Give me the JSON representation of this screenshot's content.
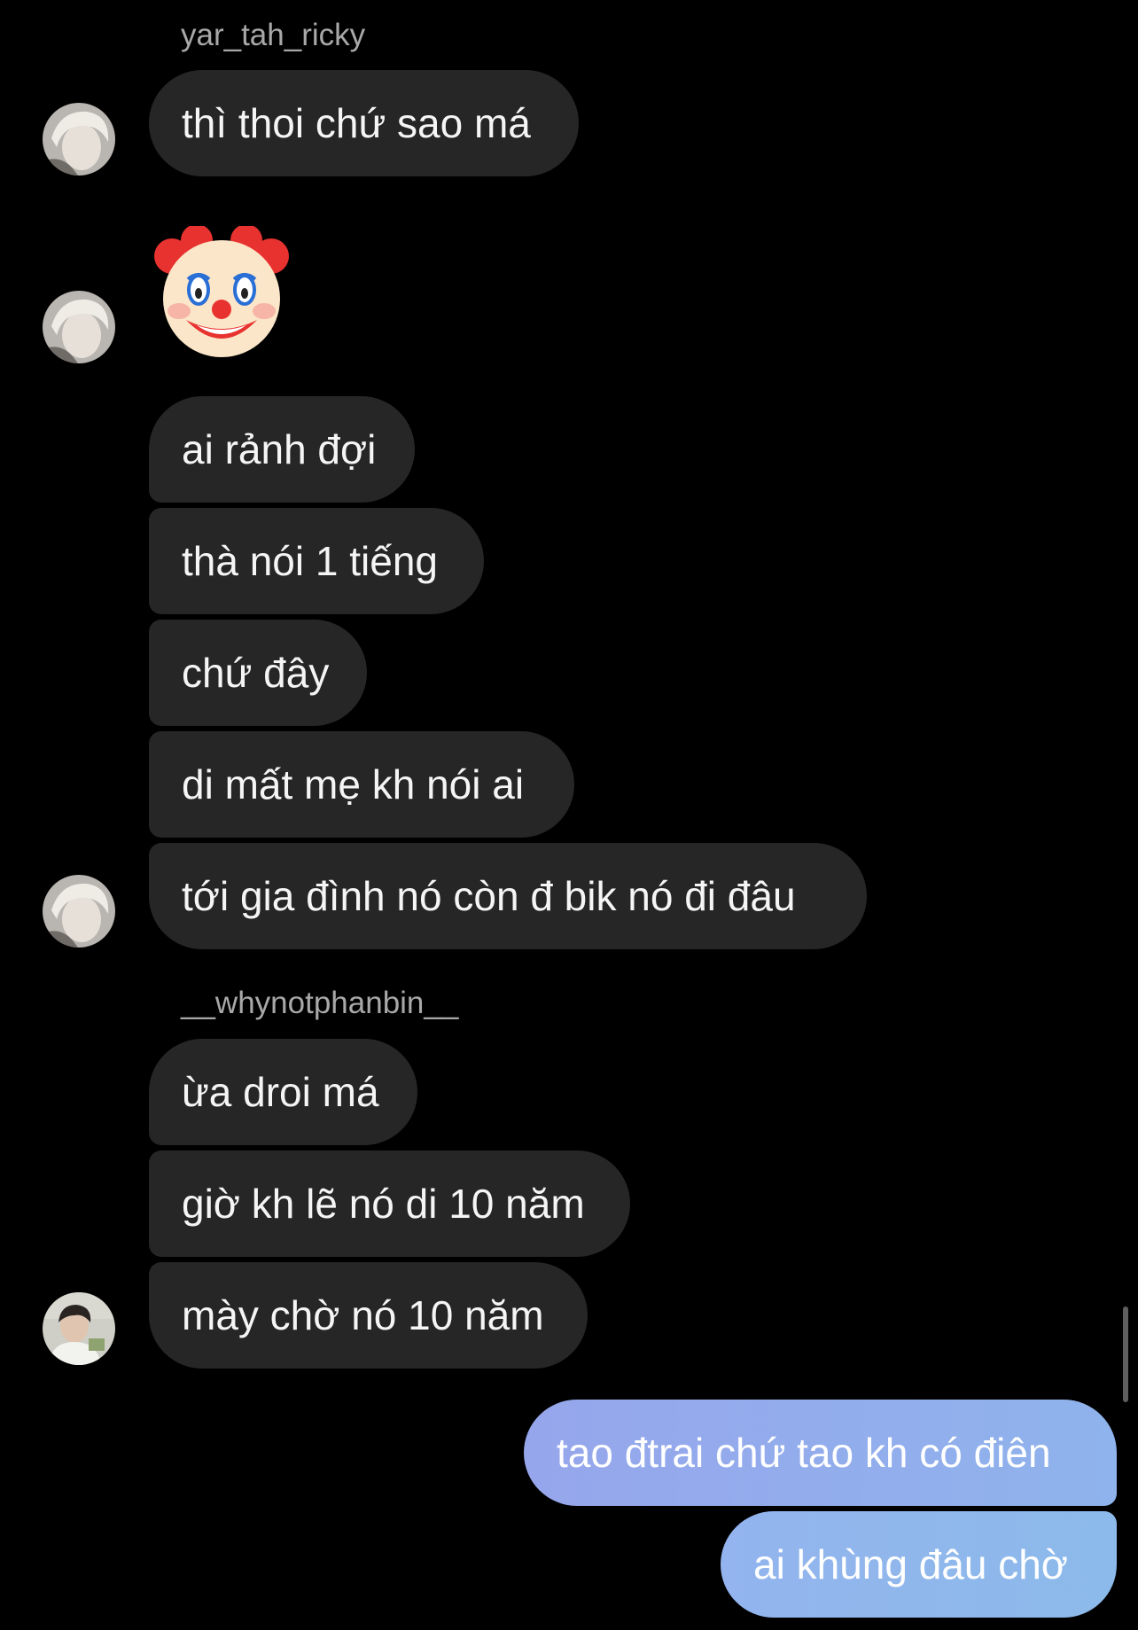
{
  "groups": [
    {
      "sender": "yar_tah_ricky",
      "messages": [
        "thì thoi chứ sao má"
      ]
    },
    {
      "emoji": "clown-face"
    },
    {
      "messages": [
        "ai rảnh đợi",
        "thà nói 1 tiếng",
        "chứ đây",
        "di mất mẹ kh nói ai",
        "tới gia đình nó còn đ bik nó đi đâu"
      ]
    },
    {
      "sender": "__whynotphanbin__",
      "messages": [
        "ừa droi má",
        "giờ kh lẽ nó di 10 năm",
        "mày chờ nó 10 năm"
      ]
    }
  ],
  "outgoing": [
    "tao đtrai chứ tao kh có điên",
    "ai khùng đâu chờ"
  ],
  "colors": {
    "background": "#000000",
    "incoming_bubble": "#262626",
    "outgoing_bubble": "#93b0ec",
    "sender_name": "#a8a8a8"
  }
}
